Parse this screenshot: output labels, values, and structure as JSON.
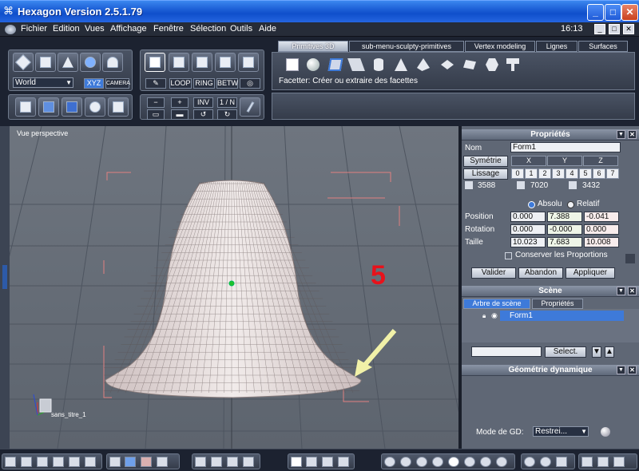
{
  "window": {
    "title": "Hexagon Version 2.5.1.79"
  },
  "menu": {
    "items": [
      "Fichier",
      "Edition",
      "Vues",
      "Affichage",
      "Fenêtre",
      "Sélection",
      "Outils",
      "Aide"
    ],
    "clock": "16:13"
  },
  "toolbar": {
    "space": "World",
    "xyz": "XYZ",
    "camera": "CAMERA",
    "loop": "LOOP",
    "ring": "RING",
    "betw": "BETW",
    "inv": "INV",
    "one_n": "1 / N",
    "minus": "−",
    "plus": "+"
  },
  "tabs": [
    "Primitives 3D",
    "sub-menu-sculpty-primitives",
    "Vertex modeling",
    "Lignes",
    "Surfaces"
  ],
  "tool_hint": "Facetter: Créer ou extraire des facettes",
  "viewport": {
    "label": "Vue perspective",
    "overlay_number": "5",
    "scene_name": "sans_titre_1"
  },
  "properties": {
    "title": "Propriétés",
    "nom_label": "Nom",
    "nom_value": "Form1",
    "symetrie": "Symétrie",
    "x": "X",
    "y": "Y",
    "z": "Z",
    "lissage": "Lissage",
    "levels": [
      "0",
      "1",
      "2",
      "3",
      "4",
      "5",
      "6",
      "7"
    ],
    "count1": "3588",
    "count2": "7020",
    "count3": "3432",
    "absolu": "Absolu",
    "relatif": "Relatif",
    "position_label": "Position",
    "position": [
      "0.000",
      "7.388",
      "-0.041"
    ],
    "rotation_label": "Rotation",
    "rotation": [
      "0.000",
      "-0.000",
      "0.000"
    ],
    "taille_label": "Taille",
    "taille": [
      "10.023",
      "7.683",
      "10.008"
    ],
    "conserver": "Conserver les Proportions",
    "valider": "Valider",
    "abandon": "Abandon",
    "appliquer": "Appliquer"
  },
  "scene": {
    "title": "Scène",
    "tab_tree": "Arbre de scène",
    "tab_props": "Propriétés",
    "item": "Form1",
    "select": "Select."
  },
  "geo": {
    "title": "Géométrie dynamique",
    "mode_label": "Mode de GD:",
    "mode_value": "Restrei..."
  },
  "colors": {
    "accent": "#2c5fd4",
    "selection": "#3e7ad9",
    "overlay": "#e8121b",
    "arrow": "#f1f1a8"
  }
}
